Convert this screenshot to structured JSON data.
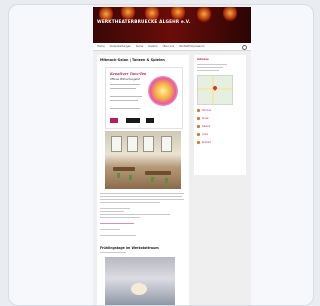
{
  "site": {
    "banner_title": "WERKTHEATERBRUECKE ALGEHR e.V.",
    "nav_items": [
      "Home",
      "Veranstaltungen",
      "Kurse",
      "Galerie",
      "Über uns",
      "Kontakt/Impressum"
    ]
  },
  "post": {
    "title": "Mitmach-Salon | Tanzen & Spielen",
    "date": "",
    "flyer_heading": "Kreativer Tanz-Tee",
    "flyer_subtitle": "Offenes Mitmachangebot"
  },
  "section2": {
    "title": "Frühlingstage im Werkstattraum"
  },
  "sidebar": {
    "title": "Adresse",
    "items": [
      "Termine",
      "Kurse",
      "Galerie",
      "Links",
      "Kontakt"
    ]
  },
  "colors": {
    "accent": "#c2185b",
    "banner": "#6a0d08"
  }
}
